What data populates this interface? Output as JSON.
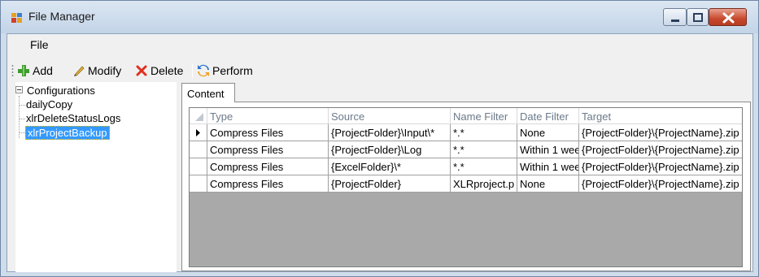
{
  "window": {
    "title": "File Manager",
    "icon": "app-window-icon",
    "controls": [
      "minimize-icon",
      "maximize-icon",
      "close-icon"
    ]
  },
  "menubar": {
    "items": [
      {
        "label": "File"
      }
    ]
  },
  "toolbar": {
    "add_label": "Add",
    "modify_label": "Modify",
    "delete_label": "Delete",
    "perform_label": "Perform",
    "icons": [
      "plus-icon",
      "pencil-icon",
      "x-delete-icon",
      "refresh-icon"
    ]
  },
  "tree": {
    "root": "Configurations",
    "children": [
      "dailyCopy",
      "xlrDeleteStatusLogs",
      "xlrProjectBackup"
    ],
    "selected": "xlrProjectBackup"
  },
  "tabs": [
    {
      "label": "Content"
    }
  ],
  "grid": {
    "columns": [
      "Type",
      "Source",
      "Name Filter",
      "Date Filter",
      "Target"
    ],
    "rows": [
      [
        "Compress Files",
        "{ProjectFolder}\\Input\\*",
        "*.*",
        "None",
        "{ProjectFolder}\\{ProjectName}.zip"
      ],
      [
        "Compress Files",
        "{ProjectFolder}\\Log",
        "*.*",
        "Within 1 wee",
        "{ProjectFolder}\\{ProjectName}.zip"
      ],
      [
        "Compress Files",
        "{ExcelFolder}\\*",
        "*.*",
        "Within 1 wee",
        "{ProjectFolder}\\{ProjectName}.zip"
      ],
      [
        "Compress Files",
        "{ProjectFolder}",
        "XLRproject.p",
        "None",
        "{ProjectFolder}\\{ProjectName}.zip"
      ]
    ],
    "current_row": 0
  },
  "colors": {
    "selection": "#3399ff",
    "window_frame": "#cfdcea",
    "close_button": "#c8492e"
  }
}
